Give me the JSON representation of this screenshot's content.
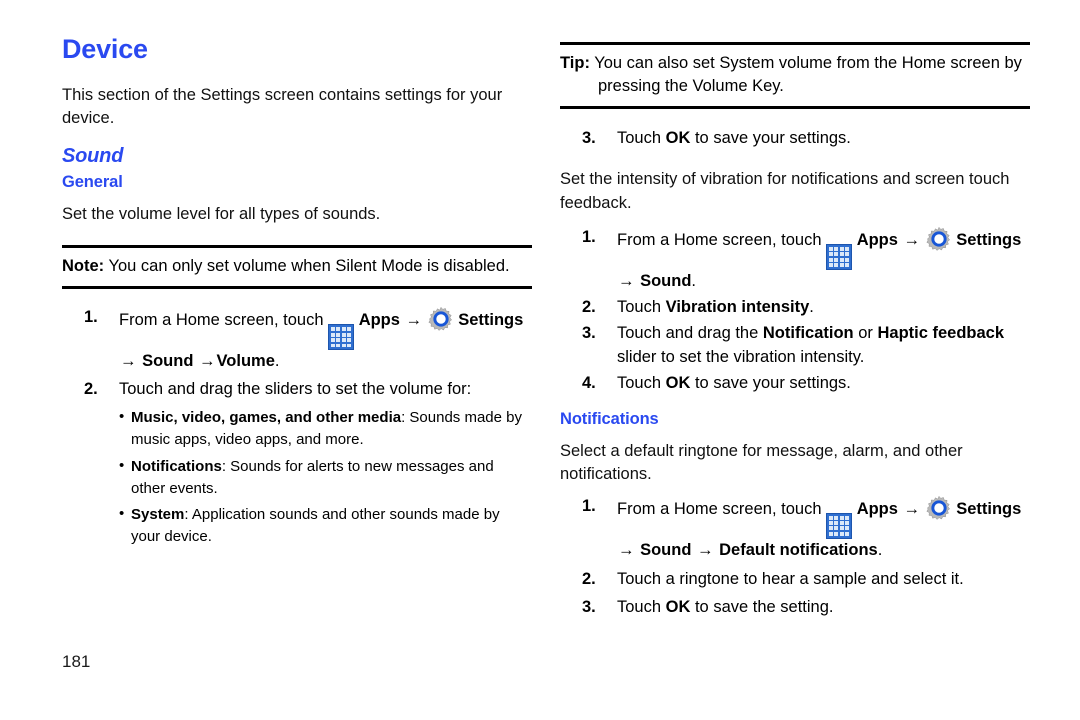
{
  "colors": {
    "heading_blue": "#2a49f0",
    "apps_icon_blue": "#2f6fd0",
    "gear_gray": "#b6b6b6",
    "gear_blue": "#1856d6",
    "rule_black": "#000000"
  },
  "icons": {
    "apps": "apps-grid-icon",
    "settings": "gear-icon",
    "arrow": "→",
    "bullet": "•"
  },
  "page_number": "181",
  "left_column": {
    "chapter_title": "Device",
    "intro": "This section of the Settings screen contains settings for your device.",
    "section_title": "Sound",
    "sub_title": "General",
    "sub_intro": "Set the volume level for all types of sounds.",
    "note": {
      "lead": "Note:",
      "text": "You can only set volume when Silent Mode is disabled."
    },
    "steps": [
      {
        "num": "1.",
        "prefix": "From a Home screen, touch",
        "apps_label": "Apps",
        "settings_label": "Settings",
        "continuation": "Sound",
        "continuation2": "Volume",
        "trailing": "."
      },
      {
        "num": "2.",
        "text": "Touch and drag the sliders to set the volume for:"
      }
    ],
    "bullets": [
      {
        "bold_parts": "Music, video, games, and other media",
        "rest": ": Sounds made by music apps, video apps, and more."
      },
      {
        "bold_parts": "Notifications",
        "rest": ": Sounds for alerts to new messages and other events."
      },
      {
        "bold_parts": "System",
        "rest": ": Application sounds and other sounds made by your device."
      }
    ]
  },
  "right_column": {
    "tip": {
      "lead": "Tip:",
      "text": "You can also set System volume from the Home screen by pressing the Volume Key."
    },
    "step3_volume": {
      "num": "3.",
      "pre": "Touch",
      "bold": "OK",
      "post": "to save your settings."
    },
    "vibration_intro": "Set the intensity of vibration for notifications and screen touch feedback.",
    "vibration_steps": [
      {
        "num": "1.",
        "prefix": "From a Home screen, touch",
        "apps_label": "Apps",
        "settings_label": "Settings",
        "continuation": "Sound",
        "trailing": "."
      },
      {
        "num": "2.",
        "pre": "Touch",
        "bold": "Vibration intensity",
        "post": "."
      },
      {
        "num": "3.",
        "pre": "Touch and drag the",
        "bold": "Notification",
        "mid": "or",
        "bold2": "Haptic feedback",
        "post": "slider to set the vibration intensity."
      },
      {
        "num": "4.",
        "pre": "Touch",
        "bold": "OK",
        "post": "to save your settings."
      }
    ],
    "notifications_title": "Notifications",
    "notifications_intro": "Select a default ringtone for message, alarm, and other notifications.",
    "notifications_steps": [
      {
        "num": "1.",
        "prefix": "From a Home screen, touch",
        "apps_label": "Apps",
        "settings_label": "Settings",
        "continuation": "Sound",
        "continuation2": "Default notifications",
        "trailing": "."
      },
      {
        "num": "2.",
        "text": "Touch a ringtone to hear a sample and select it."
      },
      {
        "num": "3.",
        "pre": "Touch",
        "bold": "OK",
        "post": "to save the setting."
      }
    ]
  }
}
